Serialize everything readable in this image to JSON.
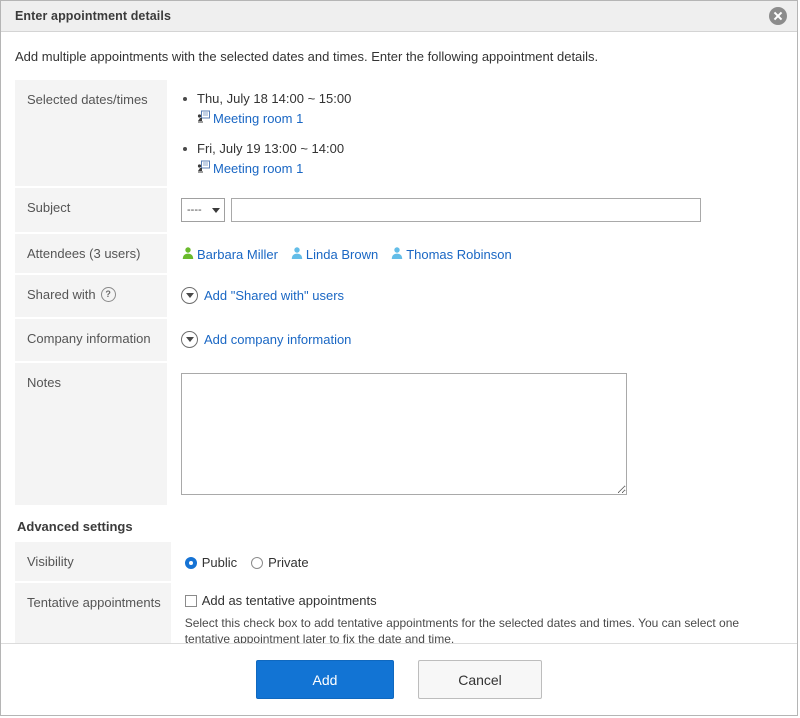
{
  "dialog": {
    "title": "Enter appointment details",
    "close_icon": "close-icon",
    "intro": "Add multiple appointments with the selected dates and times. Enter the following appointment details."
  },
  "fields": {
    "selected_dates": {
      "label": "Selected dates/times",
      "items": [
        {
          "datetime": "Thu, July 18 14:00 ~ 15:00",
          "facility": "Meeting room 1"
        },
        {
          "datetime": "Fri, July 19 13:00 ~ 14:00",
          "facility": "Meeting room 1"
        }
      ]
    },
    "subject": {
      "label": "Subject",
      "select_value": "----",
      "input_value": "",
      "input_placeholder": ""
    },
    "attendees": {
      "label": "Attendees (3 users)",
      "users": [
        {
          "name": "Barbara Miller",
          "icon_color": "#6aba2c"
        },
        {
          "name": "Linda Brown",
          "icon_color": "#63bde8"
        },
        {
          "name": "Thomas Robinson",
          "icon_color": "#63bde8"
        }
      ]
    },
    "shared_with": {
      "label": "Shared with",
      "help_icon": "help-icon",
      "add_link": "Add \"Shared with\" users"
    },
    "company_information": {
      "label": "Company information",
      "add_link": "Add company information"
    },
    "notes": {
      "label": "Notes",
      "value": "",
      "placeholder": ""
    }
  },
  "advanced": {
    "heading": "Advanced settings",
    "visibility": {
      "label": "Visibility",
      "options": [
        {
          "label": "Public",
          "selected": true
        },
        {
          "label": "Private",
          "selected": false
        }
      ]
    },
    "tentative": {
      "label": "Tentative appointments",
      "checkbox_label": "Add as tentative appointments",
      "checked": false,
      "description": "Select this check box to add tentative appointments for the selected dates and times. You can select one tentative appointment later to fix the date and time."
    }
  },
  "footer": {
    "add_label": "Add",
    "cancel_label": "Cancel"
  },
  "colors": {
    "accent": "#1274d4",
    "link": "#1a67c4",
    "label_bg": "#f4f4f4",
    "titlebar_bg": "#efefef"
  }
}
